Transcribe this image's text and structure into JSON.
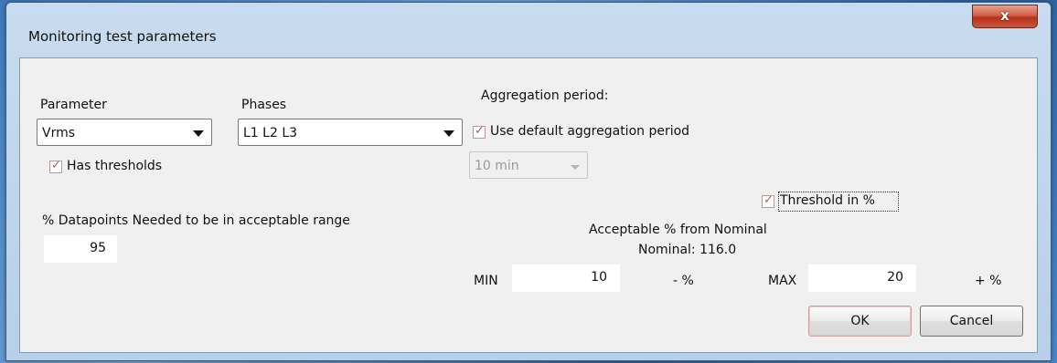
{
  "dialog": {
    "title": "Monitoring test parameters",
    "close_label": "x"
  },
  "parameter": {
    "label": "Parameter",
    "value": "Vrms",
    "has_thresholds_label": "Has thresholds",
    "has_thresholds_checked": true
  },
  "phases": {
    "label": "Phases",
    "value": "L1 L2 L3"
  },
  "aggregation": {
    "label": "Aggregation period:",
    "use_default_label": "Use default aggregation period",
    "use_default_checked": true,
    "period_value": "10 min"
  },
  "datapoints": {
    "label": "% Datapoints Needed to be in acceptable range",
    "value": "95"
  },
  "threshold": {
    "in_percent_label": "Threshold in %",
    "in_percent_checked": true,
    "acceptable_label": "Acceptable % from Nominal",
    "nominal_label": "Nominal: 116.0",
    "min_label": "MIN",
    "min_value": "10",
    "min_suffix": "- %",
    "max_label": "MAX",
    "max_value": "20",
    "max_suffix": "+ %"
  },
  "buttons": {
    "ok": "OK",
    "cancel": "Cancel"
  }
}
